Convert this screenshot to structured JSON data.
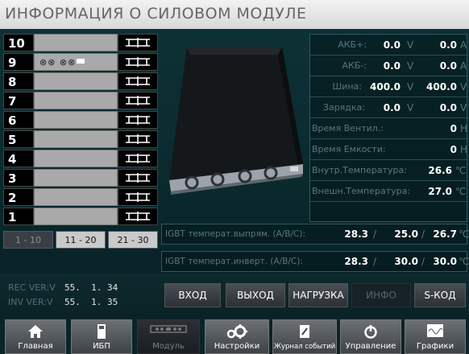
{
  "title": "ИНФОРМАЦИЯ О СИЛОВОМ МОДУЛЕ",
  "rack": {
    "slots": [
      "10",
      "9",
      "8",
      "7",
      "6",
      "5",
      "4",
      "3",
      "2",
      "1"
    ],
    "fans_text": "⊗⊗  ⊗⊗"
  },
  "pages": [
    "1 - 10",
    "11 - 20",
    "21 - 30"
  ],
  "measurements": [
    {
      "label": "АКБ+:",
      "v1": "0.0",
      "u1": "V",
      "v2": "0.0",
      "u2": "A"
    },
    {
      "label": "АКБ-:",
      "v1": "0.0",
      "u1": "V",
      "v2": "0.0",
      "u2": "A"
    },
    {
      "label": "Шина:",
      "v1": "400.0",
      "u1": "V",
      "v2": "400.0",
      "u2": "V"
    },
    {
      "label": "Зарядка:",
      "v1": "0.0",
      "u1": "V",
      "v2": "0.0",
      "u2": "V"
    }
  ],
  "fan_time": {
    "label": "Время Вентил.:",
    "value": "0",
    "unit": "H"
  },
  "cap_time": {
    "label": "Время Емкости:",
    "value": "0",
    "unit": "H"
  },
  "inner_temp": {
    "label": "Внутр.Температура:",
    "value": "26.6",
    "unit": "℃"
  },
  "outer_temp": {
    "label": "Внешн.Температура:",
    "value": "27.0",
    "unit": "℃"
  },
  "igbt_rect": {
    "label": "IGBT темперaт.выпрям. (А/В/С):",
    "a": "28.3",
    "b": "25.0",
    "c": "26.7",
    "unit": "℃"
  },
  "igbt_inv": {
    "label": "IGBT темперaт.инверт. (А/В/С):",
    "a": "28.3",
    "b": "30.0",
    "c": "30.0",
    "unit": "℃"
  },
  "versions": [
    {
      "key": "REC VER:V",
      "value": "55.  1. 34"
    },
    {
      "key": "INV VER:V",
      "value": "55.  1. 35"
    }
  ],
  "tabs": [
    "ВХОД",
    "ВЫХОД",
    "НАГРУЗКА",
    "ИНФО",
    "S-КОД"
  ],
  "nav": [
    "Главная",
    "ИБП",
    "Модуль",
    "Настройки",
    "Журнал событий",
    "Управление",
    "Графики"
  ],
  "colors": {
    "accent_text": "#59787b",
    "panel_bg": "#0b2c30"
  }
}
